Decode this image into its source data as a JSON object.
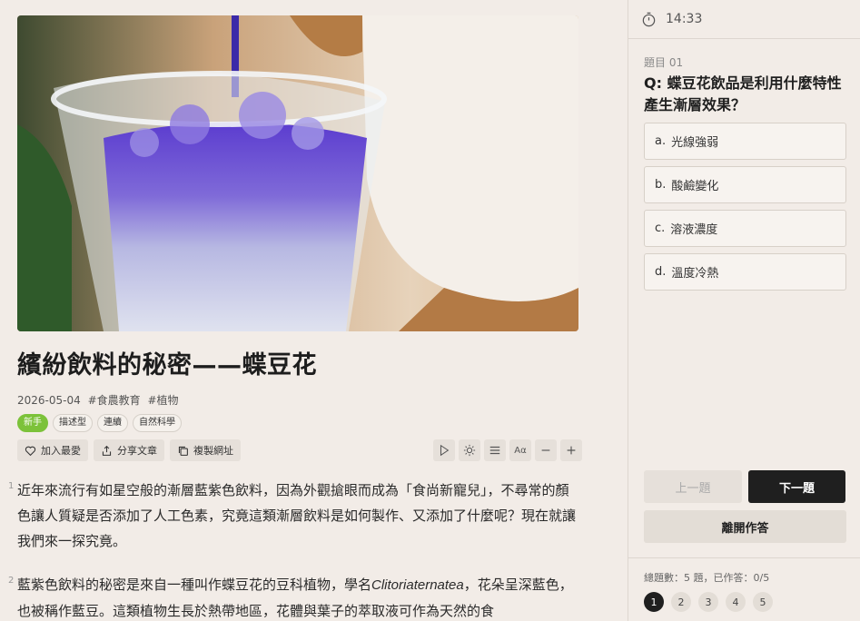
{
  "article": {
    "title": "繽紛飲料的秘密——蝶豆花",
    "date": "2026-05-04",
    "categories": [
      "#食農教育",
      "#植物"
    ],
    "level": "新手",
    "tags": [
      "描述型",
      "連續",
      "自然科學"
    ],
    "actions": {
      "favorite": "加入最愛",
      "share": "分享文章",
      "copy": "複製網址"
    },
    "tools": {
      "play_icon": "play-icon",
      "brightness_icon": "brightness-icon",
      "list_icon": "list-icon",
      "font_size_label": "Aα",
      "minus_icon": "minus-icon",
      "plus_icon": "plus-icon"
    },
    "paragraphs": [
      {
        "number": "1",
        "text": "近年來流行有如星空般的漸層藍紫色飲料，因為外觀搶眼而成為「食尚新寵兒」，不尋常的顏色讓人質疑是否添加了人工色素，究竟這類漸層飲料是如何製作、又添加了什麼呢？現在就讓我們來一探究竟。"
      },
      {
        "number": "2",
        "before": "藍紫色飲料的秘密是來自一種叫作蝶豆花的豆科植物，學名",
        "italic": "Clitoriaternatea",
        "after": "，花朵呈深藍色，也被稱作藍豆。這類植物生長於熱帶地區，花體與葉子的萃取液可作為天然的食"
      }
    ]
  },
  "quiz": {
    "timer": "14:33",
    "question_number": "題目 01",
    "question": "Q: 蝶豆花飲品是利用什麼特性產生漸層效果？",
    "options": [
      {
        "key": "a.",
        "text": "光線強弱"
      },
      {
        "key": "b.",
        "text": "酸鹼變化"
      },
      {
        "key": "c.",
        "text": "溶液濃度"
      },
      {
        "key": "d.",
        "text": "溫度冷熱"
      }
    ],
    "prev": "上一題",
    "next": "下一題",
    "leave": "離開作答",
    "summary": "總題數：5 題，已作答：0/5",
    "pages": [
      "1",
      "2",
      "3",
      "4",
      "5"
    ],
    "active_page": "1"
  }
}
